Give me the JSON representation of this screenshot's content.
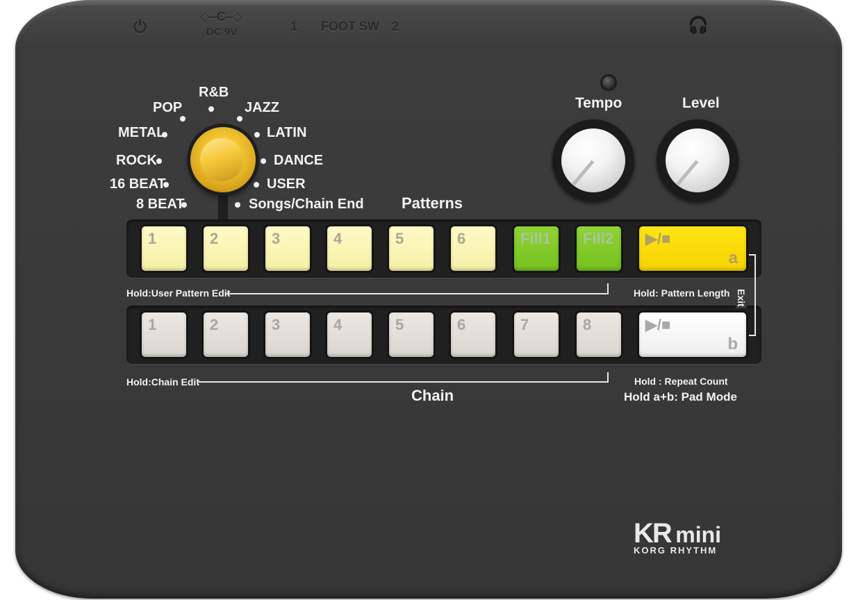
{
  "top_panel": {
    "power_symbol": "⏻",
    "dc_label": "DC 9V",
    "footsw_num1": "1",
    "footsw_label": "FOOT SW",
    "footsw_num2": "2",
    "headphone_symbol": "🎧"
  },
  "genre_selector": {
    "options": [
      "R&B",
      "POP",
      "JAZZ",
      "METAL",
      "LATIN",
      "ROCK",
      "DANCE",
      "16 BEAT",
      "USER",
      "8 BEAT",
      "Songs/Chain End"
    ],
    "icon": "rotary-selector-icon"
  },
  "knobs": {
    "tempo_label": "Tempo",
    "level_label": "Level"
  },
  "patterns": {
    "title": "Patterns",
    "pads": [
      "1",
      "2",
      "3",
      "4",
      "5",
      "6",
      "Fill1",
      "Fill2"
    ],
    "play_label": "▶/■",
    "play_letter": "a",
    "hold_left": "Hold:User Pattern Edit",
    "hold_right": "Hold: Pattern Length"
  },
  "chain": {
    "title": "Chain",
    "pads": [
      "1",
      "2",
      "3",
      "4",
      "5",
      "6",
      "7",
      "8"
    ],
    "play_label": "▶/■",
    "play_letter": "b",
    "hold_left": "Hold:Chain Edit",
    "hold_right": "Hold : Repeat Count",
    "hold_ab": "Hold a+b: Pad Mode"
  },
  "exit_label": "Exit",
  "logo": {
    "kr": "KR",
    "mini": "mini",
    "sub": "KORG RHYTHM"
  },
  "colors": {
    "body": "#3a3a3a",
    "pad_yellow": "#fbf5b5",
    "pad_green": "#80c928",
    "play_a": "#ffdd00",
    "pad_gray": "#e2ded8",
    "play_b": "#ffffff",
    "selector": "#f2c531"
  }
}
